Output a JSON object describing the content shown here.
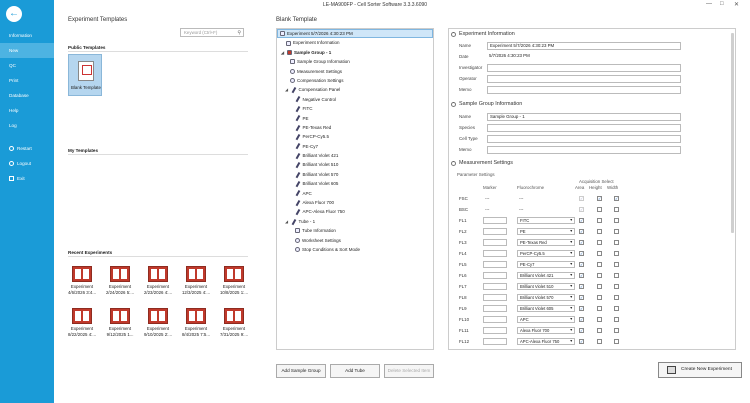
{
  "window": {
    "title": "LE-MA900FP - Cell Sorter Software 3.3.3.6090"
  },
  "sidebar": {
    "items": [
      {
        "label": "Information"
      },
      {
        "label": "New"
      },
      {
        "label": "QC"
      },
      {
        "label": "Print"
      },
      {
        "label": "Database"
      },
      {
        "label": "Help"
      },
      {
        "label": "Log"
      }
    ],
    "actions": [
      {
        "label": "Restart"
      },
      {
        "label": "Logout"
      },
      {
        "label": "Exit"
      }
    ]
  },
  "templates": {
    "heading": "Experiment Templates",
    "search_placeholder": "Keyword (Ctrl+F)",
    "public_label": "Public Templates",
    "blank_label": "Blank Template",
    "my_label": "My Templates",
    "recent_label": "Recent Experiments",
    "recent": [
      {
        "name": "Experiment",
        "date": "4/6/2026 3:4..."
      },
      {
        "name": "Experiment",
        "date": "2/24/2026 5:..."
      },
      {
        "name": "Experiment",
        "date": "2/23/2026 4:..."
      },
      {
        "name": "Experiment",
        "date": "12/3/2025 4:..."
      },
      {
        "name": "Experiment",
        "date": "10/8/2025 1:..."
      },
      {
        "name": "Experiment",
        "date": "8/22/2025 4:..."
      },
      {
        "name": "Experiment",
        "date": "9/12/2025 1..."
      },
      {
        "name": "Experiment",
        "date": "9/10/2025 2:..."
      },
      {
        "name": "Experiment",
        "date": "8/4/2025 7:5..."
      },
      {
        "name": "Experiment",
        "date": "7/31/2025 9:..."
      }
    ]
  },
  "tree": {
    "heading": "Blank Template",
    "nodes": [
      {
        "label": "Experiment 5/7/2026 4:30:23 PM"
      },
      {
        "label": "Experiment Information"
      },
      {
        "label": "Sample Group - 1"
      },
      {
        "label": "Sample Group Information"
      },
      {
        "label": "Measurement Settings"
      },
      {
        "label": "Compensation Settings"
      },
      {
        "label": "Compensation Panel"
      },
      {
        "label": "Negative Control"
      },
      {
        "label": "FITC"
      },
      {
        "label": "PE"
      },
      {
        "label": "PE-Texas Red"
      },
      {
        "label": "PerCP-Cy5.5"
      },
      {
        "label": "PE-Cy7"
      },
      {
        "label": "Brilliant Violet 421"
      },
      {
        "label": "Brilliant Violet 510"
      },
      {
        "label": "Brilliant Violet 570"
      },
      {
        "label": "Brilliant Violet 605"
      },
      {
        "label": "APC"
      },
      {
        "label": "Alexa Fluor 700"
      },
      {
        "label": "APC-Alexa Fluor 750"
      },
      {
        "label": "Tube - 1"
      },
      {
        "label": "Tube Information"
      },
      {
        "label": "Worksheet Settings"
      },
      {
        "label": "Stop Conditions & Sort Mode"
      }
    ],
    "add_group": "Add Sample Group",
    "add_tube": "Add Tube",
    "delete": "Delete Selected Item"
  },
  "props": {
    "exp_title": "Experiment Information",
    "exp": {
      "name_label": "Name",
      "name": "Experiment 5/7/2026 4:30:23 PM",
      "date_label": "Date",
      "date": "5/7/2026 4:30:23 PM",
      "investigator_label": "Investigator",
      "operator_label": "Operator",
      "memo_label": "Memo"
    },
    "sg_title": "Sample Group Information",
    "sg": {
      "name_label": "Name",
      "name": "Sample Group - 1",
      "species_label": "Species",
      "celltype_label": "Cell Type",
      "memo_label": "Memo"
    },
    "ms_title": "Measurement Settings",
    "ms": {
      "param_label": "Parameter Settings",
      "acq_label": "Acquisition Select",
      "col_marker": "Marker",
      "col_fluor": "Fluorochrome",
      "col_area": "Area",
      "col_height": "Height",
      "col_width": "Width",
      "rows": [
        {
          "ch": "FSC",
          "marker": "---",
          "fluor": "---"
        },
        {
          "ch": "BSC",
          "marker": "---",
          "fluor": "---"
        },
        {
          "ch": "FL1",
          "fluor": "FITC"
        },
        {
          "ch": "FL2",
          "fluor": "PE"
        },
        {
          "ch": "FL3",
          "fluor": "PE-Texas Red"
        },
        {
          "ch": "FL4",
          "fluor": "PerCP-Cy5.5"
        },
        {
          "ch": "FL5",
          "fluor": "PE-Cy7"
        },
        {
          "ch": "FL6",
          "fluor": "Brilliant Violet 421"
        },
        {
          "ch": "FL7",
          "fluor": "Brilliant Violet 510"
        },
        {
          "ch": "FL8",
          "fluor": "Brilliant Violet 570"
        },
        {
          "ch": "FL9",
          "fluor": "Brilliant Violet 605"
        },
        {
          "ch": "FL10",
          "fluor": "APC"
        },
        {
          "ch": "FL11",
          "fluor": "Alexa Fluor 700"
        },
        {
          "ch": "FL12",
          "fluor": "APC-Alexa Fluor 750"
        }
      ]
    }
  },
  "footer": {
    "create": "Create New Experiment"
  }
}
